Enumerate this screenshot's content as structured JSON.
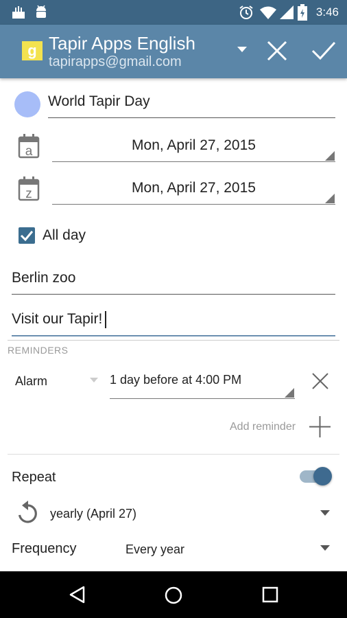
{
  "status_bar": {
    "time": "3:46"
  },
  "toolbar": {
    "account_name": "Tapir Apps English",
    "account_email": "tapirapps@gmail.com",
    "account_icon_letter": "g",
    "close_icon": "close-icon",
    "save_icon": "check-icon"
  },
  "event": {
    "title": "World Tapir Day",
    "start_date": "Mon, April 27, 2015",
    "end_date": "Mon, April 27, 2015",
    "start_icon_letter": "a",
    "end_icon_letter": "z",
    "all_day_label": "All day",
    "all_day_checked": true,
    "location": "Berlin zoo",
    "description": "Visit our Tapir!"
  },
  "reminders": {
    "header": "REMINDERS",
    "items": [
      {
        "type": "Alarm",
        "time": "1 day before at 4:00 PM"
      }
    ],
    "add_label": "Add reminder"
  },
  "repeat": {
    "label": "Repeat",
    "enabled": true,
    "rule": "yearly (April 27)",
    "frequency_label": "Frequency",
    "frequency_value": "Every year"
  },
  "colors": {
    "status_bar": "#3d6584",
    "toolbar": "#5b86a8",
    "accent": "#3b6d8f",
    "event_color": "#a7bdf8"
  }
}
